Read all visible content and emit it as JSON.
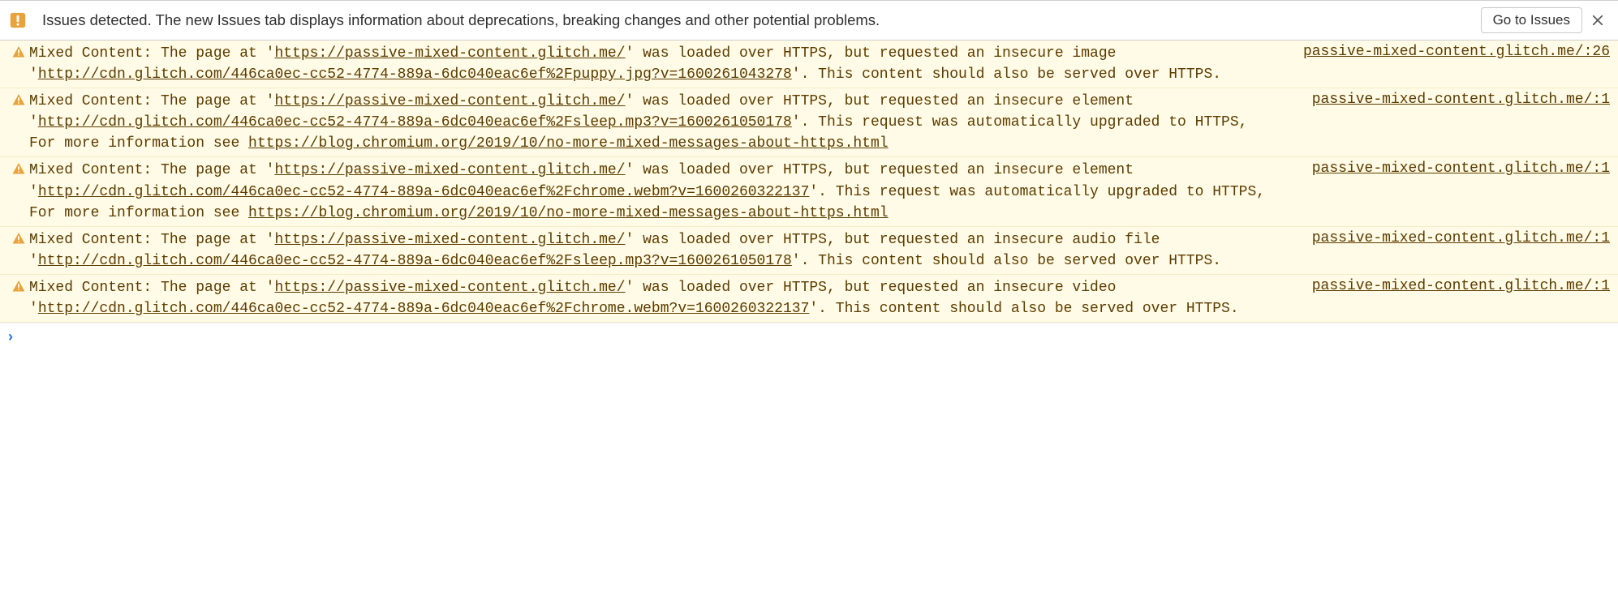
{
  "issuesBar": {
    "text": "Issues detected. The new Issues tab displays information about deprecations, breaking changes and other potential problems.",
    "button": "Go to Issues"
  },
  "pageUrl": "https://passive-mixed-content.glitch.me/",
  "blogUrl": "https://blog.chromium.org/2019/10/no-more-mixed-messages-about-https.html",
  "warnings": [
    {
      "source": "passive-mixed-content.glitch.me/:26",
      "parts": [
        {
          "t": "Mixed Content: The page at '"
        },
        {
          "l": "https://passive-mixed-content.glitch.me/"
        },
        {
          "t": "' was loaded over HTTPS, but requested an insecure image '"
        },
        {
          "l": "http://cdn.glitch.com/446ca0ec-cc52-4774-889a-6dc040eac6ef%2Fpuppy.jpg?v=1600261043278"
        },
        {
          "t": "'. This content should also be served over HTTPS."
        }
      ]
    },
    {
      "source": "passive-mixed-content.glitch.me/:1",
      "parts": [
        {
          "t": "Mixed Content: The page at '"
        },
        {
          "l": "https://passive-mixed-content.glitch.me/"
        },
        {
          "t": "' was loaded over HTTPS, but requested an insecure element '"
        },
        {
          "l": "http://cdn.glitch.com/446ca0ec-cc52-4774-889a-6dc040eac6ef%2Fsleep.mp3?v=1600261050178"
        },
        {
          "t": "'. This request was automatically upgraded to HTTPS, For more information see "
        },
        {
          "l": "https://blog.chromium.org/2019/10/no-more-mixed-messages-about-https.html"
        }
      ]
    },
    {
      "source": "passive-mixed-content.glitch.me/:1",
      "parts": [
        {
          "t": "Mixed Content: The page at '"
        },
        {
          "l": "https://passive-mixed-content.glitch.me/"
        },
        {
          "t": "' was loaded over HTTPS, but requested an insecure element '"
        },
        {
          "l": "http://cdn.glitch.com/446ca0ec-cc52-4774-889a-6dc040eac6ef%2Fchrome.webm?v=1600260322137"
        },
        {
          "t": "'. This request was automatically upgraded to HTTPS, For more information see "
        },
        {
          "l": "https://blog.chromium.org/2019/10/no-more-mixed-messages-about-https.html"
        }
      ]
    },
    {
      "source": "passive-mixed-content.glitch.me/:1",
      "parts": [
        {
          "t": "Mixed Content: The page at '"
        },
        {
          "l": "https://passive-mixed-content.glitch.me/"
        },
        {
          "t": "' was loaded over HTTPS, but requested an insecure audio file '"
        },
        {
          "l": "http://cdn.glitch.com/446ca0ec-cc52-4774-889a-6dc040eac6ef%2Fsleep.mp3?v=1600261050178"
        },
        {
          "t": "'. This content should also be served over HTTPS."
        }
      ]
    },
    {
      "source": "passive-mixed-content.glitch.me/:1",
      "parts": [
        {
          "t": "Mixed Content: The page at '"
        },
        {
          "l": "https://passive-mixed-content.glitch.me/"
        },
        {
          "t": "' was loaded over HTTPS, but requested an insecure video '"
        },
        {
          "l": "http://cdn.glitch.com/446ca0ec-cc52-4774-889a-6dc040eac6ef%2Fchrome.webm?v=1600260322137"
        },
        {
          "t": "'. This content should also be served over HTTPS."
        }
      ]
    }
  ],
  "prompt": {
    "caret": "›"
  }
}
